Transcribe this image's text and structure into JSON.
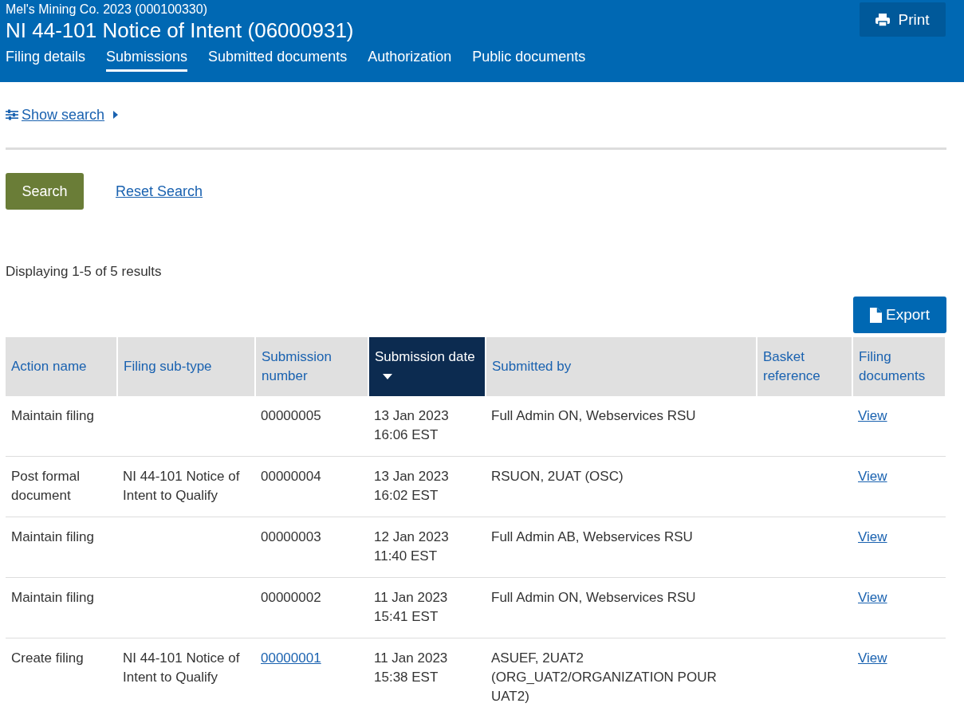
{
  "header": {
    "company": "Mel's Mining Co. 2023 (000100330)",
    "title": "NI 44-101 Notice of Intent (06000931)",
    "print_button": "Print"
  },
  "tabs": [
    {
      "label": "Filing details",
      "selected": false
    },
    {
      "label": "Submissions",
      "selected": true
    },
    {
      "label": "Submitted documents",
      "selected": false
    },
    {
      "label": "Authorization",
      "selected": false
    },
    {
      "label": "Public documents",
      "selected": false
    }
  ],
  "search": {
    "toggle": "Show search",
    "expanded": false,
    "search_button": "Search",
    "reset_link": "Reset Search"
  },
  "results_summary": "Displaying 1-5 of 5 results",
  "export_button": "Export",
  "table": {
    "columns": [
      {
        "label": "Action name",
        "sorted": false
      },
      {
        "label": "Filing sub-type",
        "sorted": false
      },
      {
        "label": "Submission number",
        "sorted": false
      },
      {
        "label": "Submission date",
        "sorted": true
      },
      {
        "label": "Submitted by",
        "sorted": false
      },
      {
        "label": "Basket reference",
        "sorted": false
      },
      {
        "label": "Filing documents",
        "sorted": false
      }
    ],
    "rows": [
      {
        "action": "Maintain filing",
        "sub_type": "",
        "number": "00000005",
        "number_link": false,
        "date": "13 Jan 2023",
        "time": "16:06 EST",
        "submitted_by": "Full Admin ON, Webservices RSU",
        "documents": "View"
      },
      {
        "action": "Post formal document",
        "sub_type": "NI 44-101 Notice of Intent to Qualify",
        "number": "00000004",
        "number_link": false,
        "date": "13 Jan 2023",
        "time": "16:02 EST",
        "submitted_by": "RSUON, 2UAT (OSC)",
        "documents": "View"
      },
      {
        "action": "Maintain filing",
        "sub_type": "",
        "number": "00000003",
        "number_link": false,
        "date": "12 Jan 2023",
        "time": "11:40 EST",
        "submitted_by": "Full Admin AB, Webservices RSU",
        "documents": "View"
      },
      {
        "action": "Maintain filing",
        "sub_type": "",
        "number": "00000002",
        "number_link": false,
        "date": "11 Jan 2023",
        "time": "15:41 EST",
        "submitted_by": "Full Admin ON, Webservices RSU",
        "documents": "View"
      },
      {
        "action": "Create filing",
        "sub_type": "NI 44-101 Notice of Intent to Qualify",
        "number": "00000001",
        "number_link": true,
        "date": "11 Jan 2023",
        "time": "15:38 EST",
        "submitted_by": "ASUEF, 2UAT2 (ORG_UAT2/ORGANIZATION POUR UAT2)",
        "documents": "View"
      }
    ]
  }
}
